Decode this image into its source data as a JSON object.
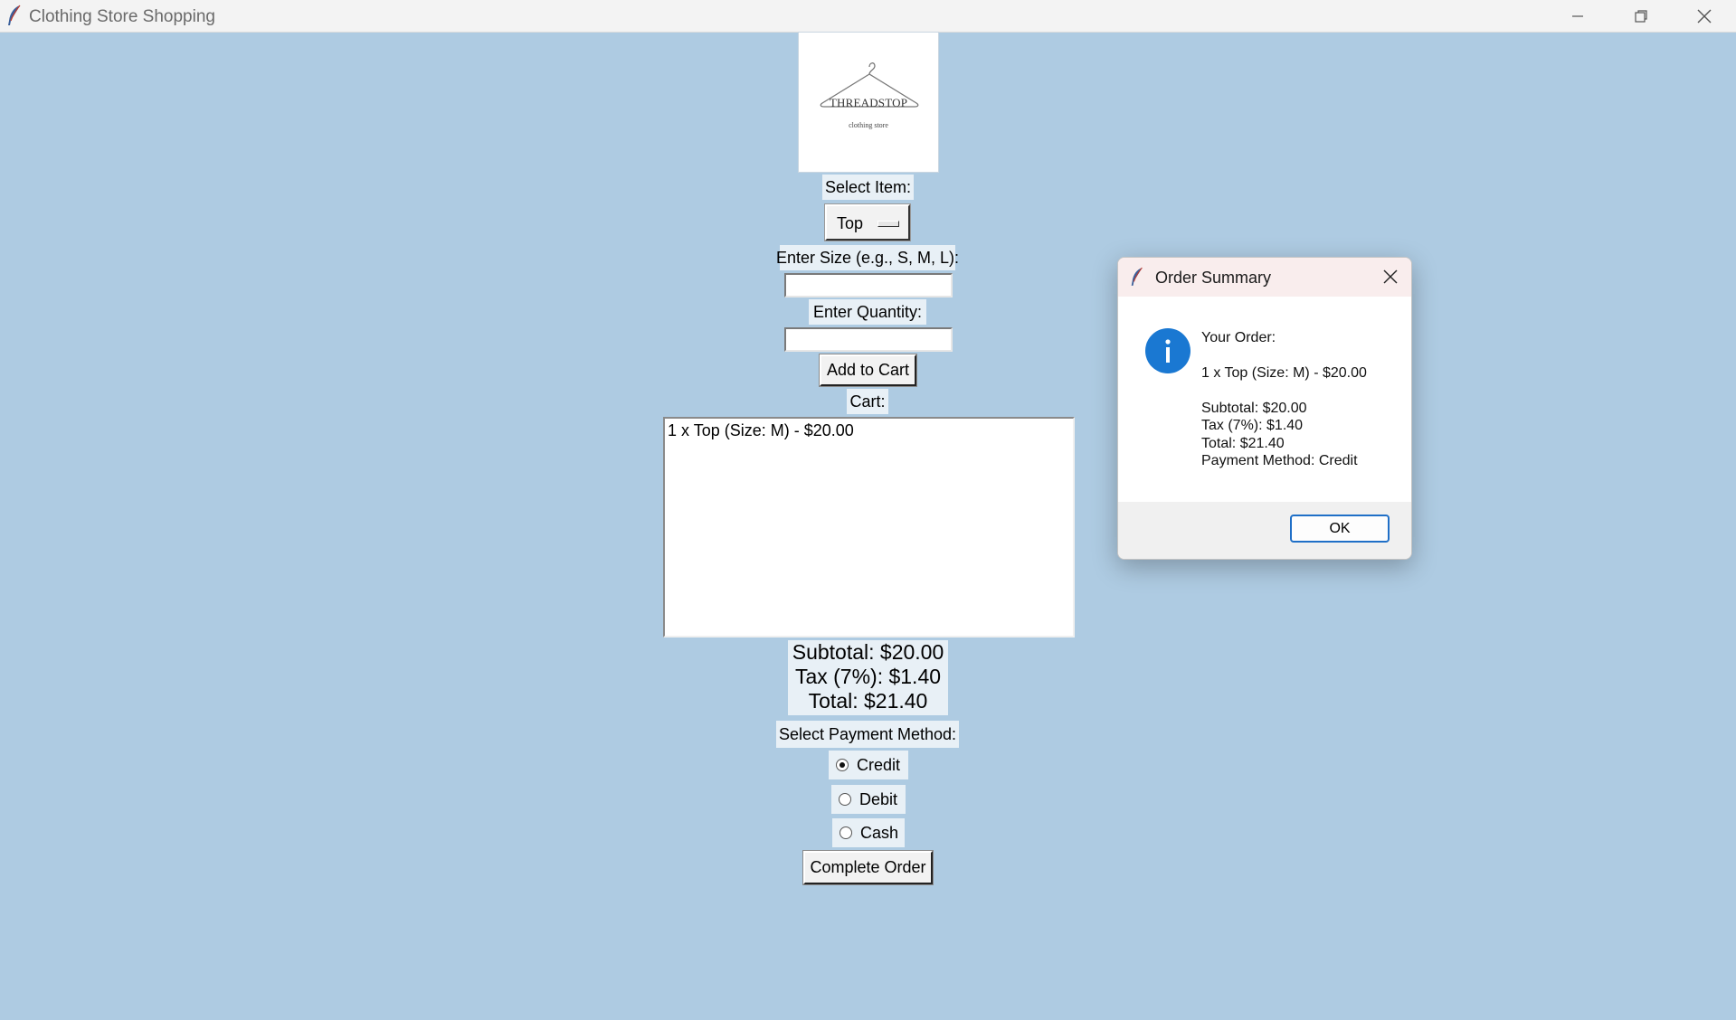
{
  "window": {
    "title": "Clothing Store Shopping",
    "icons": [
      "feather-app-icon",
      "minimize-icon",
      "restore-icon",
      "close-icon"
    ]
  },
  "logo": {
    "brand": "THREADSTOP",
    "tagline": "clothing store"
  },
  "form": {
    "select_item_label": "Select Item:",
    "selected_item": "Top",
    "size_label": "Enter Size (e.g., S, M, L):",
    "size_value": "",
    "quantity_label": "Enter Quantity:",
    "quantity_value": "",
    "add_to_cart_label": "Add to Cart",
    "cart_label": "Cart:"
  },
  "cart": {
    "items": [
      "1 x Top (Size: M) - $20.00"
    ]
  },
  "totals": {
    "subtotal": "Subtotal: $20.00",
    "tax": "Tax (7%): $1.40",
    "total": "Total: $21.40"
  },
  "payment": {
    "label": "Select Payment Method:",
    "options": [
      {
        "label": "Credit",
        "selected": true
      },
      {
        "label": "Debit",
        "selected": false
      },
      {
        "label": "Cash",
        "selected": false
      }
    ],
    "complete_label": "Complete Order"
  },
  "dialog": {
    "title": "Order Summary",
    "heading": "Your Order:",
    "item_line": "1 x Top (Size: M) - $20.00",
    "subtotal": "Subtotal: $20.00",
    "tax": "Tax (7%): $1.40",
    "total": "Total: $21.40",
    "payment": "Payment Method: Credit",
    "ok_label": "OK",
    "icon": "info-icon"
  },
  "colors": {
    "background": "#aecbe2",
    "label_bg": "#e8f0f6",
    "info_blue": "#1a78d2",
    "ok_border": "#1f6fc7"
  }
}
